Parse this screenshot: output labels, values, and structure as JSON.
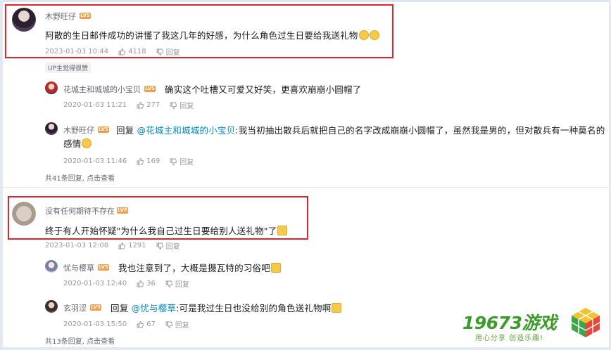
{
  "comments": [
    {
      "username": "木野旺仔",
      "level": "LV5",
      "text": "阿散的生日邮件成功的讲懂了我这几年的好感，为什么角色过生日要给我送礼物",
      "timestamp": "2023-01-03 10:44",
      "likes": "4118",
      "reply_label": "回复",
      "up_tag": "UP主觉得很赞",
      "replies": [
        {
          "username": "花城主和城城的小宝贝",
          "level": "LV5",
          "text": "确实这个吐槽又可爱又好笑，更喜欢崩崩小圆帽了",
          "timestamp": "2020-01-03 11:21",
          "likes": "277",
          "reply_label": "回复"
        },
        {
          "username": "木野旺仔",
          "level": "LV5",
          "reply_prefix": "回复",
          "mention": "@花城主和城城的小宝贝",
          "text_line1": ":我当初抽出散兵后就把自己的名字改成崩崩小圆帽了，虽然我是男的，但对散兵有一种莫名的",
          "text_line2": "感情",
          "timestamp": "2020-01-03 11:46",
          "likes": "169",
          "reply_label": "回复"
        }
      ],
      "more_text": "共41条回复, 点击查看"
    },
    {
      "username": "没有任何期待不存在",
      "level": "LV6",
      "text": "终于有人开始怀疑\"为什么我自己过生日要给别人送礼物\"了",
      "timestamp": "2023-01-03 12:08",
      "likes": "1291",
      "reply_label": "回复",
      "replies": [
        {
          "username": "忧与樱草",
          "level": "LV5",
          "text": "我也注意到了，大概是摄瓦特的习俗吧",
          "timestamp": "2020-01-03 12:40",
          "likes": "36",
          "reply_label": "回复"
        },
        {
          "username": "玄羽涩",
          "level": "LV5",
          "reply_prefix": "回复",
          "mention": "@忧与樱草",
          "text": ":可是我过生日也没给别的角色送礼物啊",
          "timestamp": "2020-01-03 15:50",
          "likes": "67",
          "reply_label": "回复"
        }
      ],
      "more_text": "共13条回复, 点击查看"
    }
  ],
  "logo": {
    "name": "19673游戏",
    "slogan": "用心分享  创造乐趣!"
  },
  "colors": {
    "highlight": "#e0242b",
    "level_badge": "#f69b45",
    "mention": "#008ac5",
    "logo_green": "#3d9b2c"
  }
}
